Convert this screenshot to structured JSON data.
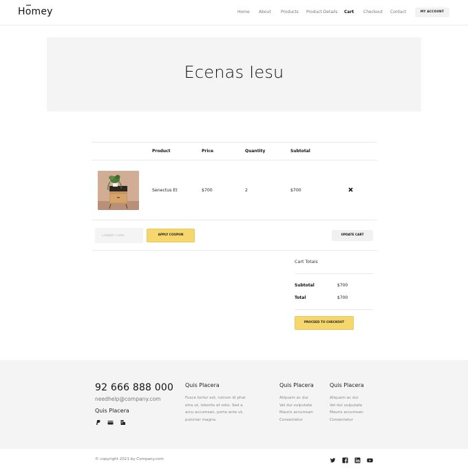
{
  "brand": {
    "logo_prefix": "H",
    "logo_o": "o",
    "logo_suffix": "mey"
  },
  "nav": {
    "items": [
      "Home",
      "About",
      "Products",
      "Product Details",
      "Cart",
      "Checkout",
      "Contact"
    ],
    "active": "Cart",
    "account_label": "MY ACCOUNT"
  },
  "hero": {
    "title": "Ecenas Iesu"
  },
  "cart": {
    "headers": {
      "product": "Product",
      "price": "Price",
      "quantity": "Quantity",
      "subtotal": "Subtotal"
    },
    "rows": [
      {
        "product": "Senectus Et",
        "price": "$700",
        "quantity": "2",
        "subtotal": "$700",
        "remove_icon": "close-icon"
      }
    ],
    "coupon_placeholder": "Coupon Code",
    "apply_label": "APPLY COUPON",
    "update_label": "UPDATE CART"
  },
  "totals": {
    "title": "Cart Totals",
    "subtotal_label": "Subtotal",
    "subtotal_value": "$700",
    "total_label": "Total",
    "total_value": "$700",
    "proceed_label": "PROCEED TO CHECKOUT"
  },
  "footer": {
    "phone": "92 666 888 000",
    "email": "needhelp@company.com",
    "subtitle": "Quis Placera",
    "payment_icons": [
      "paypal-icon",
      "credit-card-icon",
      "bank-icon"
    ],
    "columns": [
      {
        "title": "Quis Placera",
        "lines": [
          "Fusce tortor est, rutrum id phar",
          "etra ut, lobortis et odio. Sed a",
          "arcu accumsan, porta ante ut,",
          "pulvinar magna."
        ]
      },
      {
        "title": "Quis Placera",
        "lines": [
          "Aliquam ac dui",
          "Vel dui vulputate",
          "Mauris accumsan",
          "Consectetur"
        ]
      },
      {
        "title": "Quis Placera",
        "lines": [
          "Aliquam ac dui",
          "Vel dui vulputate",
          "Mauris accumsan",
          "Consectetur"
        ]
      }
    ],
    "copyright": "© copyright 2021 by Company.com",
    "social_icons": [
      "twitter-icon",
      "facebook-icon",
      "linkedin-icon",
      "youtube-icon"
    ]
  },
  "colors": {
    "accent": "#f5d76e",
    "panel": "#f4f4f4",
    "text": "#222222"
  }
}
